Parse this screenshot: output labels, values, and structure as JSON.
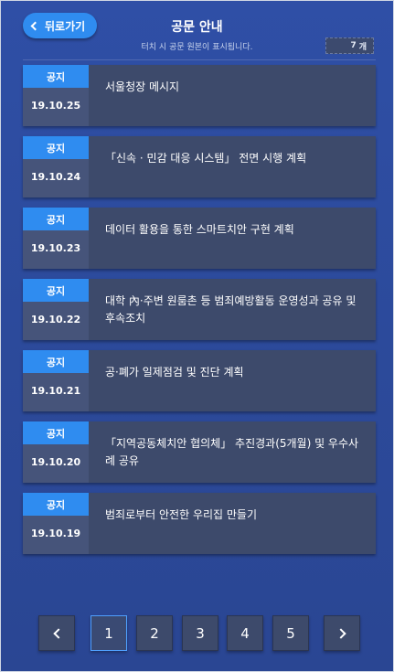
{
  "header": {
    "back_label": "뒤로가기",
    "title": "공문 안내",
    "subtitle": "터치 시 공문 원본이 표시됩니다.",
    "count_value": "7",
    "count_unit": "개"
  },
  "notices": [
    {
      "tag": "공지",
      "date": "19.10.25",
      "title": "서울청장 메시지"
    },
    {
      "tag": "공지",
      "date": "19.10.24",
      "title": "「신속 · 민감 대응 시스템」 전면 시행 계획"
    },
    {
      "tag": "공지",
      "date": "19.10.23",
      "title": "데이터 활용을 통한 스마트치안 구현 계획"
    },
    {
      "tag": "공지",
      "date": "19.10.22",
      "title": "대학 內·주변 원룸촌 등 범죄예방활동 운영성과 공유 및 후속조치"
    },
    {
      "tag": "공지",
      "date": "19.10.21",
      "title": "공·폐가 일제점검 및 진단 계획"
    },
    {
      "tag": "공지",
      "date": "19.10.20",
      "title": "「지역공동체치안 협의체」 추진경과(5개월) 및 우수사례 공유"
    },
    {
      "tag": "공지",
      "date": "19.10.19",
      "title": "범죄로부터 안전한 우리집 만들기"
    }
  ],
  "pagination": {
    "pages": [
      "1",
      "2",
      "3",
      "4",
      "5"
    ],
    "current": "1",
    "prev_icon": "chevron-left-icon",
    "next_icon": "chevron-right-icon"
  },
  "colors": {
    "background": "#2e4c9e",
    "accent": "#2f8cf0",
    "card": "#3d4a6b"
  }
}
